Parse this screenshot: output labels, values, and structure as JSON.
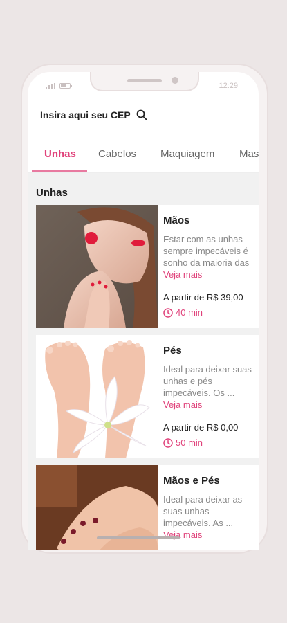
{
  "status": {
    "time": "12:29"
  },
  "search": {
    "placeholder": "Insira aqui seu CEP"
  },
  "tabs": [
    {
      "label": "Unhas",
      "active": true
    },
    {
      "label": "Cabelos",
      "active": false
    },
    {
      "label": "Maquiagem",
      "active": false
    },
    {
      "label": "Mas",
      "active": false
    }
  ],
  "section": {
    "title": "Unhas"
  },
  "cards": [
    {
      "title": "Mãos",
      "description": "Estar com as unhas sempre impecáveis é sonho da maioria das",
      "more": "Veja mais",
      "price": "A partir de R$ 39,00",
      "duration": "40 min"
    },
    {
      "title": "Pés",
      "description": "Ideal para deixar suas unhas e pés impecáveis. Os ...",
      "more": "Veja mais",
      "price": "A partir de R$ 0,00",
      "duration": "50 min"
    },
    {
      "title": "Mãos e Pés",
      "description": "Ideal para deixar as suas unhas impecáveis. As ...",
      "more": "Veja mais"
    }
  ],
  "colors": {
    "accent": "#e0417a",
    "underline": "#e87aa0"
  }
}
